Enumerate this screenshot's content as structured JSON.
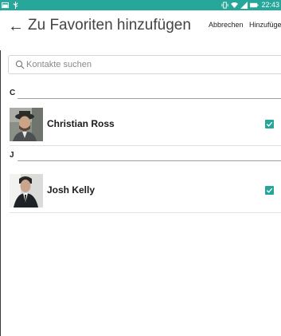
{
  "status_bar": {
    "time": "22:43",
    "accent": "#27a69a"
  },
  "app_bar": {
    "title": "Zu Favoriten hinzufügen",
    "back_icon": "arrow-left-icon",
    "cancel_label": "Abbrechen",
    "add_label": "Hinzufügen"
  },
  "search": {
    "placeholder": "Kontakte suchen",
    "value": ""
  },
  "sections": [
    {
      "letter": "C",
      "contacts": [
        {
          "name": "Christian Ross",
          "checked": true
        }
      ]
    },
    {
      "letter": "J",
      "contacts": [
        {
          "name": "Josh Kelly",
          "checked": true
        }
      ]
    }
  ]
}
